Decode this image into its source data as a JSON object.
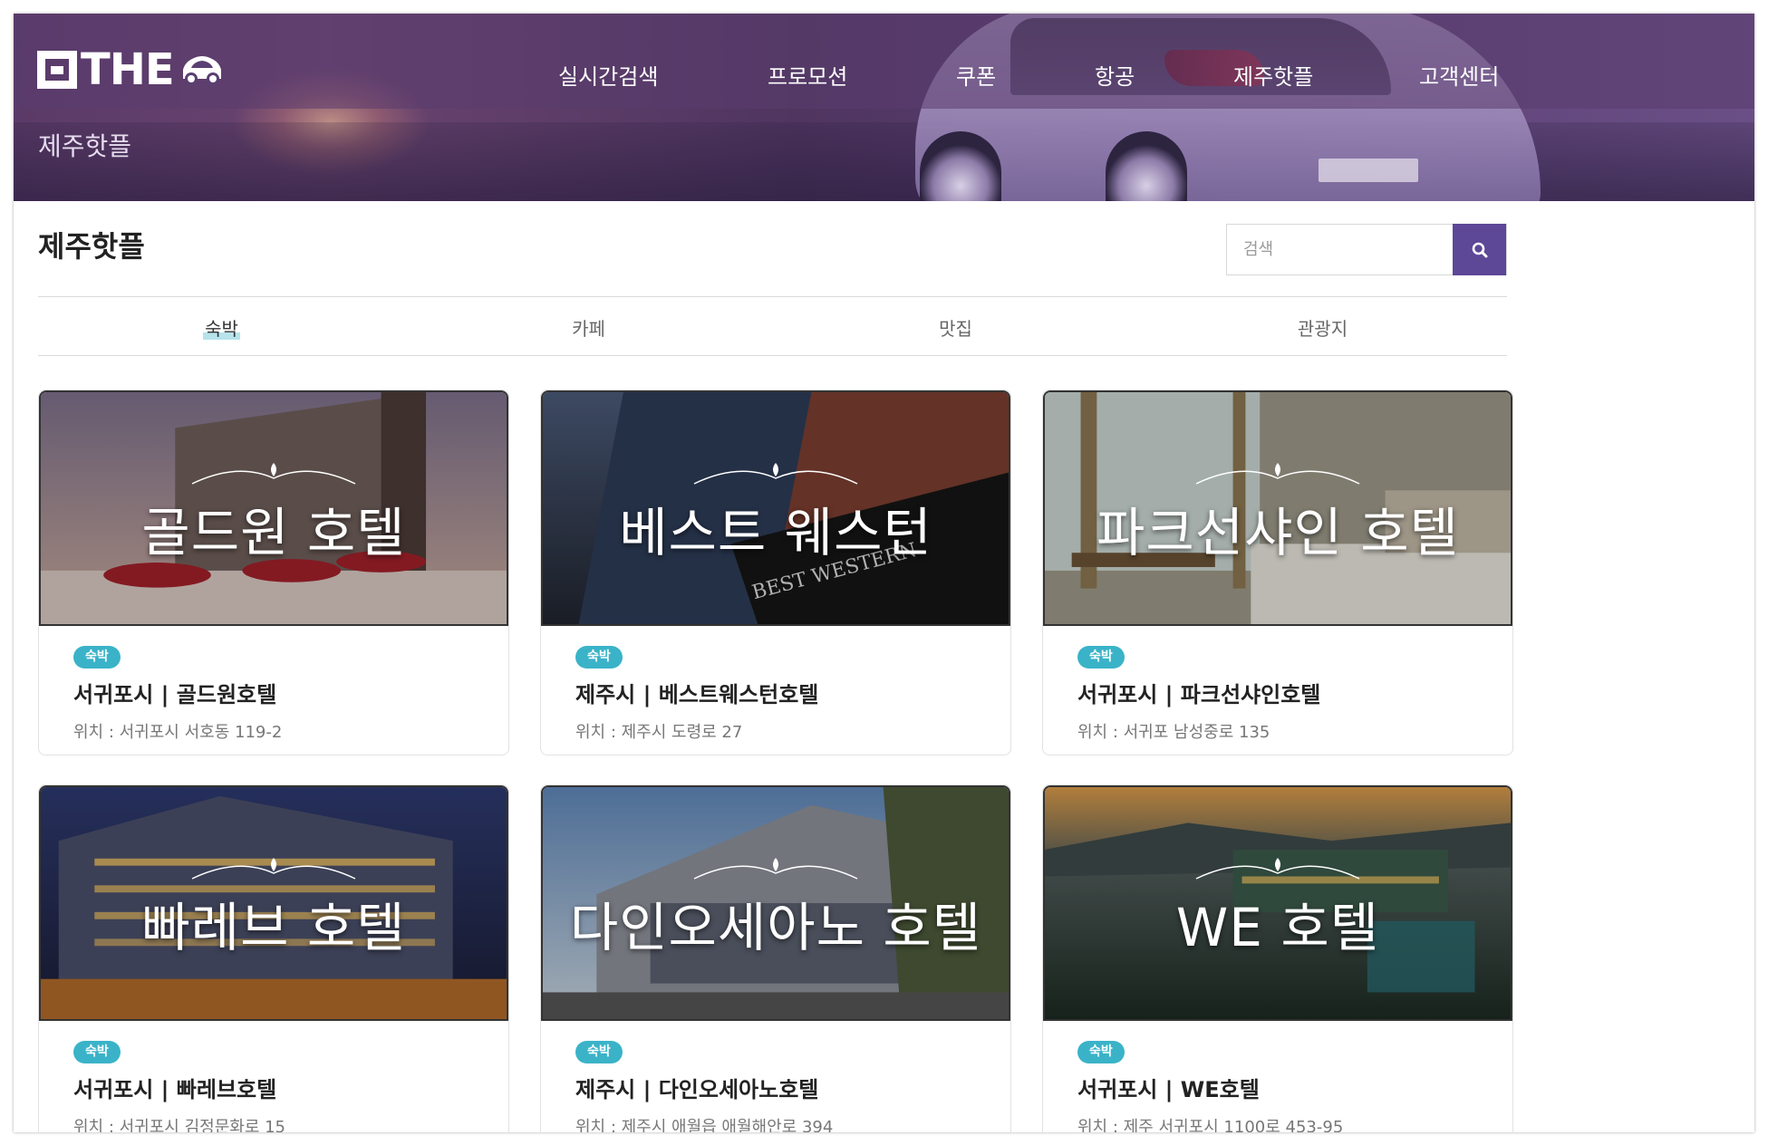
{
  "header": {
    "logo_text": "THE",
    "nav": [
      "실시간검색",
      "프로모션",
      "쿠폰",
      "항공",
      "제주핫플",
      "고객센터"
    ],
    "subtitle": "제주핫플"
  },
  "main": {
    "page_title": "제주핫플",
    "search": {
      "placeholder": "검색",
      "value": ""
    },
    "tabs": [
      {
        "label": "숙박",
        "active": true
      },
      {
        "label": "카페",
        "active": false
      },
      {
        "label": "맛집",
        "active": false
      },
      {
        "label": "관광지",
        "active": false
      }
    ],
    "cards": [
      {
        "image_title": "골드원 호텔",
        "badge": "숙박",
        "title": "서귀포시 | 골드원호텔",
        "location": "위치 : 서귀포시 서호동 119-2"
      },
      {
        "image_title": "베스트 웨스턴",
        "badge": "숙박",
        "title": "제주시 | 베스트웨스턴호텔",
        "location": "위치 : 제주시 도령로 27"
      },
      {
        "image_title": "파크선샤인 호텔",
        "badge": "숙박",
        "title": "서귀포시 | 파크선샤인호텔",
        "location": "위치 : 서귀포 남성중로 135"
      },
      {
        "image_title": "빠레브 호텔",
        "badge": "숙박",
        "title": "서귀포시 | 빠레브호텔",
        "location": "위치 : 서귀포시 김정문화로 15"
      },
      {
        "image_title": "다인오세아노 호텔",
        "badge": "숙박",
        "title": "제주시 | 다인오세아노호텔",
        "location": "위치 : 제주시 애월읍 애월해안로 394"
      },
      {
        "image_title": "WE 호텔",
        "badge": "숙박",
        "title": "서귀포시 | WE호텔",
        "location": "위치 : 제주 서귀포시 1100로 453-95"
      }
    ],
    "image_sign_text": "BEST WESTERN"
  },
  "colors": {
    "accent": "#5d4797",
    "badge": "#3ab3c8",
    "tab_highlight": "#b6e3ec"
  },
  "icons": {
    "search_button": "search-icon",
    "logo_car": "car-icon",
    "ornament": "leaf-ornament-icon"
  }
}
